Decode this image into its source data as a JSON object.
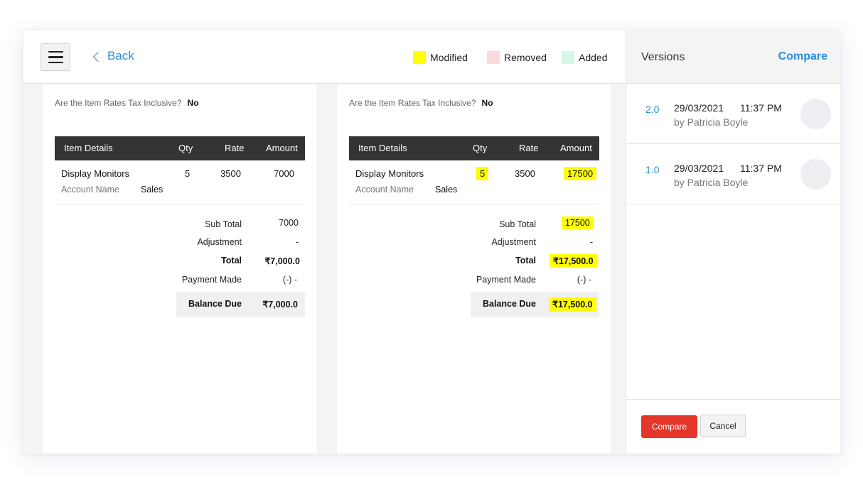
{
  "header": {
    "back_label": "Back",
    "legend": [
      {
        "label": "Modified",
        "color": "#ffff00"
      },
      {
        "label": "Removed",
        "color": "#fbdada"
      },
      {
        "label": "Added",
        "color": "#d3f7e4"
      }
    ]
  },
  "documents": [
    {
      "tax_question": "Are the Item Rates Tax Inclusive?",
      "tax_answer": "No",
      "columns": [
        "Item Details",
        "Qty",
        "Rate",
        "Amount"
      ],
      "item": {
        "name": "Display Monitors",
        "qty": "5",
        "rate": "3500",
        "amount": "7000",
        "account_label": "Account Name",
        "account_value": "Sales"
      },
      "totals": {
        "sub_total_label": "Sub Total",
        "sub_total": "7000",
        "adjustment_label": "Adjustment",
        "adjustment": "-",
        "total_label": "Total",
        "total": "₹7,000.0",
        "payment_label": "Payment Made",
        "payment": "(-) -",
        "balance_label": "Balance Due",
        "balance": "₹7,000.0"
      }
    },
    {
      "tax_question": "Are the Item Rates Tax Inclusive?",
      "tax_answer": "No",
      "columns": [
        "Item Details",
        "Qty",
        "Rate",
        "Amount"
      ],
      "item": {
        "name": "Display Monitors",
        "qty": "5",
        "rate": "3500",
        "amount": "17500",
        "account_label": "Account Name",
        "account_value": "Sales"
      },
      "totals": {
        "sub_total_label": "Sub Total",
        "sub_total": "17500",
        "adjustment_label": "Adjustment",
        "adjustment": "-",
        "total_label": "Total",
        "total": "₹17,500.0",
        "payment_label": "Payment Made",
        "payment": "(-) -",
        "balance_label": "Balance Due",
        "balance": "₹17,500.0"
      }
    }
  ],
  "sidebar": {
    "title": "Versions",
    "compare_link": "Compare",
    "versions": [
      {
        "number": "2.0",
        "date": "29/03/2021",
        "time": "11:37 PM",
        "by": "by Patricia Boyle"
      },
      {
        "number": "1.0",
        "date": "29/03/2021",
        "time": "11:37 PM",
        "by": "by Patricia Boyle"
      }
    ],
    "compare_button": "Compare",
    "cancel_button": "Cancel"
  }
}
